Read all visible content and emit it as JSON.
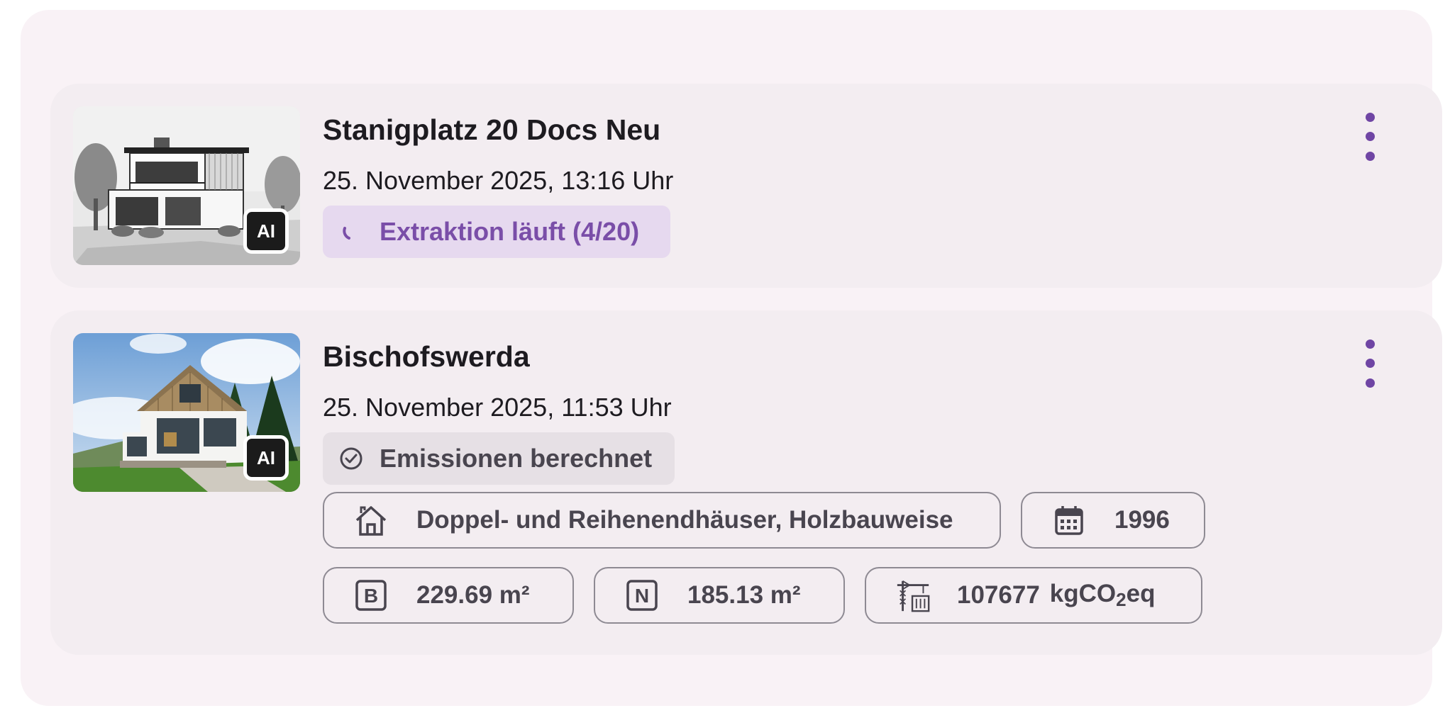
{
  "projects": [
    {
      "title": "Stanigplatz 20 Docs Neu",
      "date": "25. November 2025, 13:16 Uhr",
      "ai_badge": "AI",
      "status": "Extraktion läuft (4/20)",
      "status_icon": "spinner-icon",
      "thumbnail": "modern-house-sketch"
    },
    {
      "title": "Bischofswerda",
      "date": "25. November 2025, 11:53 Uhr",
      "ai_badge": "AI",
      "status": "Emissionen berechnet",
      "status_icon": "check-circle-icon",
      "thumbnail": "gabled-house-photo",
      "chips": {
        "building_type": "Doppel- und Reihenendhäuser, Holzbauweise",
        "year": "1996",
        "b_letter": "B",
        "b_area": "229.69 m²",
        "n_letter": "N",
        "n_area": "185.13 m²",
        "co2_value": "107677",
        "co2_unit_prefix": "kgCO",
        "co2_unit_sub": "2",
        "co2_unit_suffix": "eq"
      }
    }
  ],
  "colors": {
    "accent": "#6f45a4",
    "status_running_bg": "#e6d9ef",
    "status_done_bg": "#e6e0e5"
  }
}
